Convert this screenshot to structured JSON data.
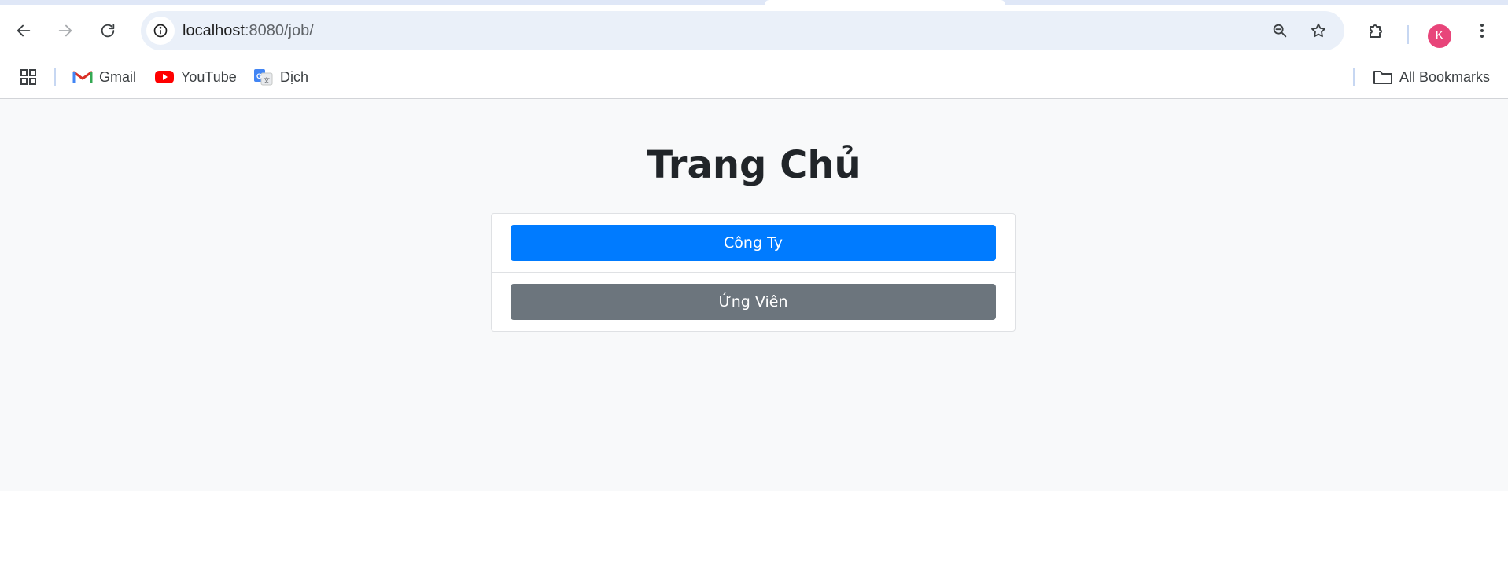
{
  "browser": {
    "url_host": "localhost",
    "url_path": ":8080/job/",
    "avatar_initial": "K",
    "nav_icons": [
      "back-icon",
      "forward-icon",
      "reload-icon"
    ],
    "omnibox_icons": [
      "site-info-icon",
      "zoom-icon",
      "bookmark-star-icon"
    ],
    "toolbar_icons": [
      "extensions-icon",
      "menu-kebab-icon"
    ]
  },
  "bookmarks_bar": {
    "items": [
      {
        "label": "Gmail",
        "icon": "gmail-icon"
      },
      {
        "label": "YouTube",
        "icon": "youtube-icon"
      },
      {
        "label": "Dịch",
        "icon": "google-translate-icon"
      }
    ],
    "all_bookmarks_label": "All Bookmarks"
  },
  "page": {
    "title": "Trang Chủ",
    "buttons": [
      {
        "label": "Công Ty",
        "style": "primary"
      },
      {
        "label": "Ứng Viên",
        "style": "secondary"
      }
    ]
  },
  "colors": {
    "primary": "#007bff",
    "secondary": "#6c757d",
    "page_bg": "#f8f9fa",
    "avatar_bg": "#e8457a",
    "omnibox_bg": "#eaf0f9"
  }
}
